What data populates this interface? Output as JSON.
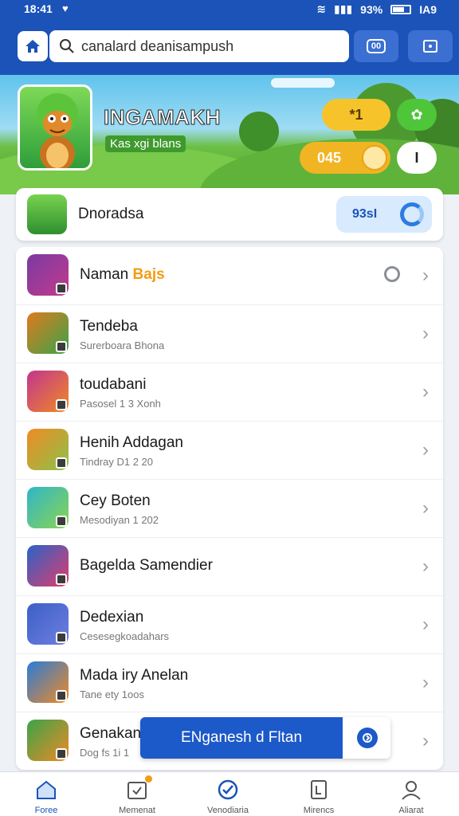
{
  "status_bar": {
    "time": "18:41",
    "battery": "93%",
    "right_label": "IA9"
  },
  "topbar": {
    "search_placeholder": "canalard deanisampush",
    "button_1_label": "00",
    "button_2_label": ""
  },
  "hero": {
    "title": "INGAMAKH",
    "subtitle": "Kas xgi blans",
    "pill_1": "*1",
    "pill_3": "045",
    "pill_4": "I"
  },
  "featured": {
    "name": "Dnoradsa",
    "badge": "93sI"
  },
  "list": [
    {
      "title": "Naman",
      "hot": "Bajs",
      "sub": "",
      "icon_colors": [
        "#7a3aa3",
        "#c23a8c"
      ]
    },
    {
      "title": "Tendeba",
      "sub": "Surerboara Bhona",
      "icon_colors": [
        "#e07a1f",
        "#3aa34a"
      ]
    },
    {
      "title": "toudabani",
      "sub": "Pasosel 1 3 Xonh",
      "icon_colors": [
        "#c2358f",
        "#f08a24"
      ]
    },
    {
      "title": "Henih Addagan",
      "sub": "Tindray D1 2 20",
      "icon_colors": [
        "#f08a24",
        "#8bc34a"
      ]
    },
    {
      "title": "Cey Boten",
      "sub": "Mesodiyan 1 202",
      "icon_colors": [
        "#2fb6c9",
        "#8bd450"
      ]
    },
    {
      "title": "Bagelda Samendier",
      "sub": "",
      "icon_colors": [
        "#2a63c9",
        "#e23c6a"
      ]
    },
    {
      "title": "Dedexian",
      "sub": "Cesesegkoadahars",
      "icon_colors": [
        "#3b5fc7",
        "#6f7fe0"
      ]
    },
    {
      "title": "Mada iry Anelan",
      "sub": "Tane ety 1oos",
      "icon_colors": [
        "#2a7bd9",
        "#f08a24"
      ]
    },
    {
      "title": "Genakan",
      "sub": "Dog fs 1i 1",
      "icon_colors": [
        "#3aa34a",
        "#f08a24"
      ]
    }
  ],
  "banner": {
    "label": "ENganesh d Fltan"
  },
  "bottom_nav": [
    {
      "label": "Foree",
      "active": true
    },
    {
      "label": "Memenat",
      "active": false
    },
    {
      "label": "Venodiaria",
      "active": false
    },
    {
      "label": "Mirencs",
      "active": false
    },
    {
      "label": "Aliarat",
      "active": false
    }
  ],
  "colors": {
    "primary": "#1b53b8",
    "accent": "#f39c12",
    "green": "#4fc53a",
    "yellow": "#f6c42a"
  }
}
